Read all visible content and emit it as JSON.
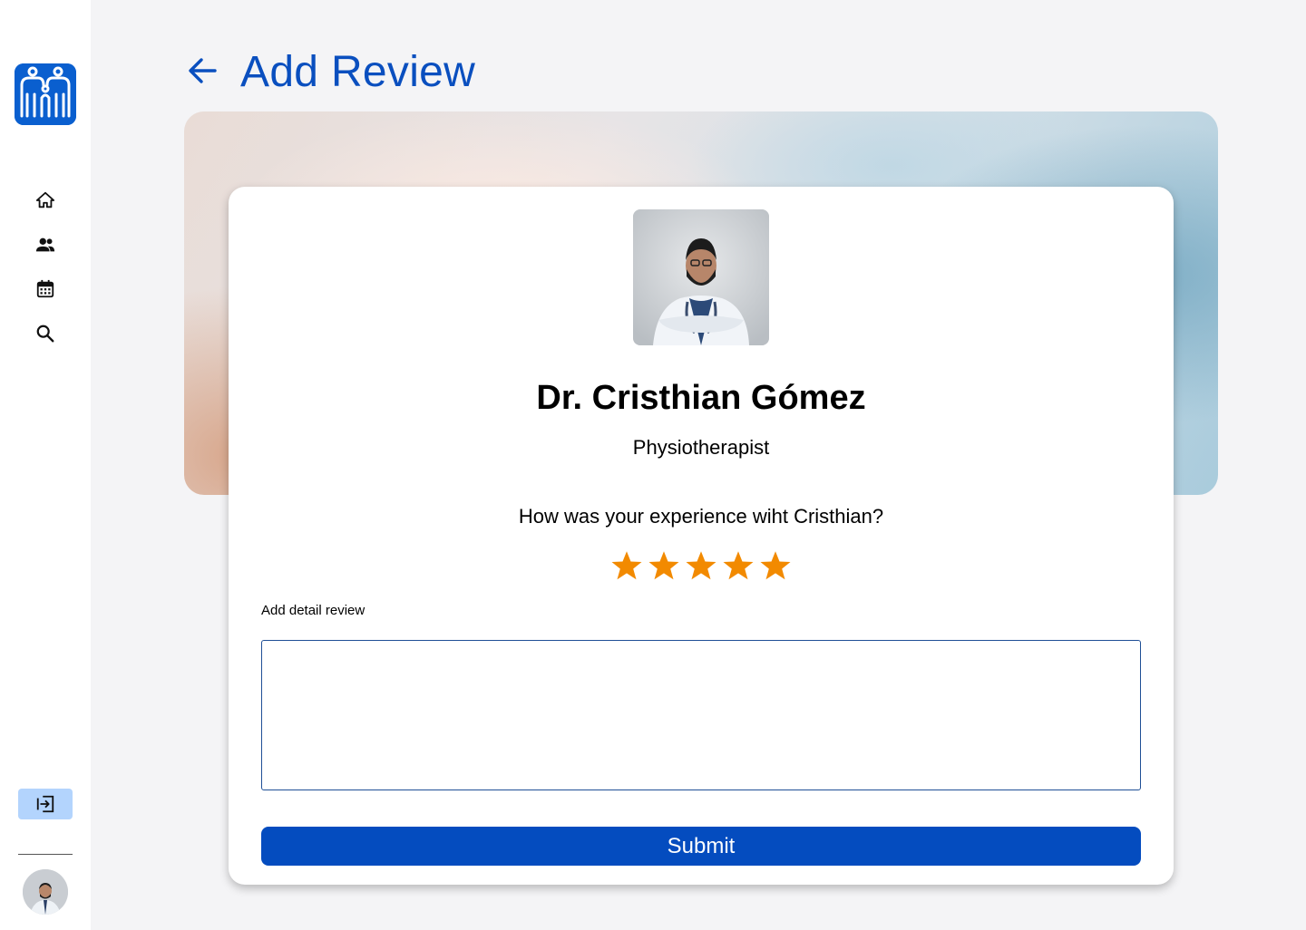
{
  "app": {
    "logo_icon": "family-clinic-logo",
    "accent_color": "#0a4fbf"
  },
  "sidebar": {
    "items": [
      {
        "icon": "home-icon",
        "label": "Home"
      },
      {
        "icon": "people-icon",
        "label": "Patients"
      },
      {
        "icon": "calendar-icon",
        "label": "Calendar"
      },
      {
        "icon": "search-icon",
        "label": "Search"
      }
    ],
    "logout_icon": "logout-icon",
    "user_avatar_icon": "user-avatar"
  },
  "header": {
    "back_icon": "arrow-left-icon",
    "title": "Add Review"
  },
  "doctor": {
    "name": "Dr. Cristhian Gómez",
    "specialty": "Physiotherapist"
  },
  "review": {
    "question": "How was your experience wiht Cristhian?",
    "rating": 5,
    "max_rating": 5,
    "star_color": "#f28a00",
    "detail_label": "Add detail review",
    "detail_value": "",
    "submit_label": "Submit",
    "submit_color": "#044cbf"
  }
}
